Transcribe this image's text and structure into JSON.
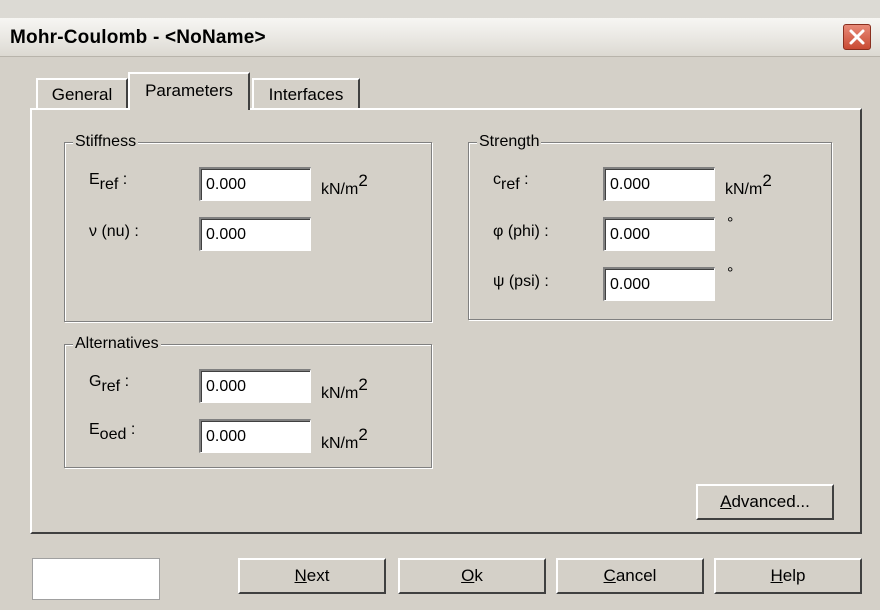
{
  "window": {
    "title": "Mohr-Coulomb - <NoName>"
  },
  "tabs": [
    {
      "label": "General",
      "active": false
    },
    {
      "label": "Parameters",
      "active": true
    },
    {
      "label": "Interfaces",
      "active": false
    }
  ],
  "stiffness": {
    "legend": "Stiffness",
    "e_ref": {
      "symbol": "E",
      "sub": "ref",
      "suffix": " :",
      "value": "0.000",
      "unit": "kN/m",
      "unit_sup": "2"
    },
    "nu": {
      "label": "ν (nu) :",
      "value": "0.000"
    }
  },
  "strength": {
    "legend": "Strength",
    "c_ref": {
      "symbol": "c",
      "sub": "ref",
      "suffix": " :",
      "value": "0.000",
      "unit": "kN/m",
      "unit_sup": "2"
    },
    "phi": {
      "label": "φ (phi) :",
      "value": "0.000",
      "unit": "°"
    },
    "psi": {
      "label": "ψ (psi) :",
      "value": "0.000",
      "unit": "°"
    }
  },
  "alternatives": {
    "legend": "Alternatives",
    "g_ref": {
      "symbol": "G",
      "sub": "ref",
      "suffix": " :",
      "value": "0.000",
      "unit": "kN/m",
      "unit_sup": "2"
    },
    "e_oed": {
      "symbol": "E",
      "sub": "oed",
      "suffix": " :",
      "value": "0.000",
      "unit": "kN/m",
      "unit_sup": "2"
    }
  },
  "buttons": {
    "advanced": {
      "mnemonic": "A",
      "rest": "dvanced..."
    },
    "next": {
      "mnemonic": "N",
      "rest": "ext"
    },
    "ok": {
      "mnemonic": "O",
      "rest": "k"
    },
    "cancel": {
      "mnemonic": "C",
      "rest": "ancel"
    },
    "help": {
      "mnemonic": "H",
      "rest": "elp"
    }
  },
  "icons": {
    "close": "close-icon"
  },
  "colors": {
    "close_button": "#c94a33",
    "selection": "#7c7c7c"
  }
}
